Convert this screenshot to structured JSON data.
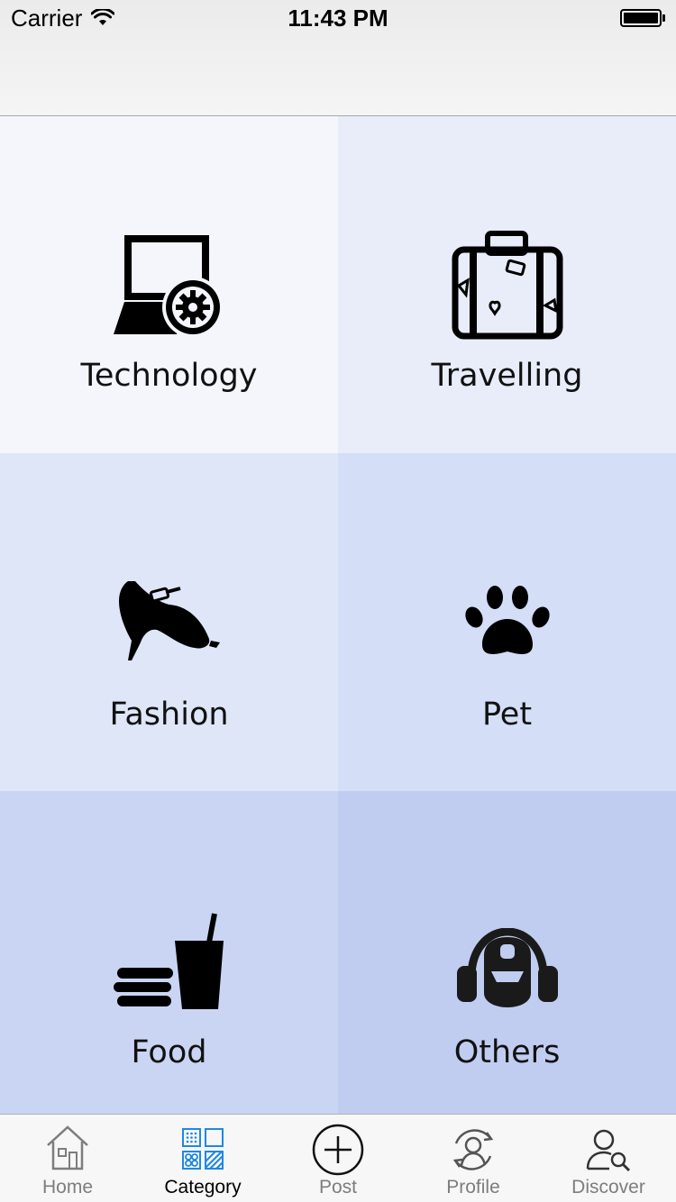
{
  "status": {
    "carrier": "Carrier",
    "time": "11:43 PM"
  },
  "colors": {
    "cell_technology": "#f4f6fb",
    "cell_travelling": "#e8edf9",
    "cell_fashion": "#dfe6f8",
    "cell_pet": "#d4def6",
    "cell_food": "#c9d5f3",
    "cell_others": "#c0cdf1",
    "tab_active_accent": "#1e88e5"
  },
  "categories": [
    {
      "label": "Technology",
      "icon": "laptop-gear-icon"
    },
    {
      "label": "Travelling",
      "icon": "suitcase-icon"
    },
    {
      "label": "Fashion",
      "icon": "high-heel-shoe-icon"
    },
    {
      "label": "Pet",
      "icon": "paw-icon"
    },
    {
      "label": "Food",
      "icon": "burger-drink-icon"
    },
    {
      "label": "Others",
      "icon": "headphones-person-icon"
    }
  ],
  "tabs": [
    {
      "label": "Home",
      "icon": "home-icon",
      "active": false
    },
    {
      "label": "Category",
      "icon": "category-grid-icon",
      "active": true
    },
    {
      "label": "Post",
      "icon": "plus-circle-icon",
      "active": false
    },
    {
      "label": "Profile",
      "icon": "profile-refresh-icon",
      "active": false
    },
    {
      "label": "Discover",
      "icon": "user-search-icon",
      "active": false
    }
  ]
}
